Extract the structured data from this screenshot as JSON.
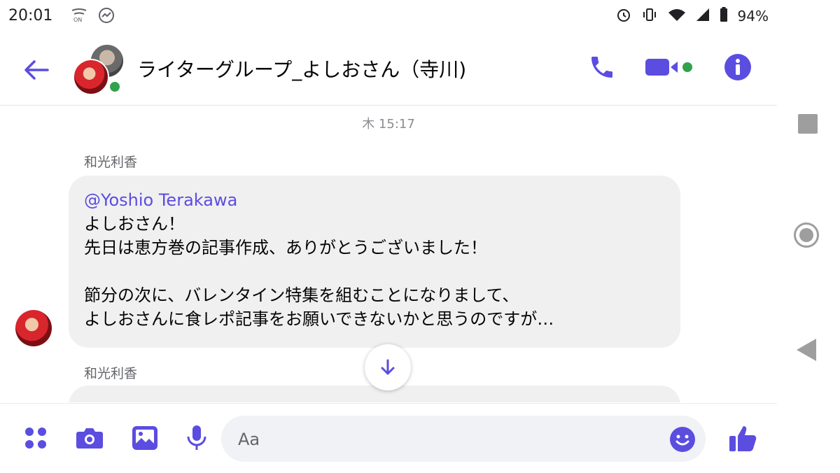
{
  "status_bar": {
    "time": "20:01",
    "battery": "94%"
  },
  "header": {
    "title": "ライターグループ_よしおさん（寺川)"
  },
  "chat": {
    "timestamp": "木 15:17",
    "messages": [
      {
        "sender": "和光利香",
        "mention": "@Yoshio Terakawa",
        "body": "よしおさん！\n先日は恵方巻の記事作成、ありがとうございました！\n\n節分の次に、バレンタイン特集を組むことになりまして、\nよしおさんに食レポ記事をお願いできないかと思うのですが…"
      },
      {
        "sender": "和光利香"
      }
    ]
  },
  "composer": {
    "placeholder": "Aa"
  },
  "colors": {
    "accent": "#5b4de0",
    "online": "#31a24c",
    "bubble": "#f0f0f0"
  },
  "icons": {
    "back": "arrow-left-icon",
    "call": "phone-icon",
    "video": "video-camera-icon",
    "info": "info-icon",
    "apps": "four-dots-icon",
    "camera": "camera-icon",
    "gallery": "image-icon",
    "mic": "microphone-icon",
    "emoji": "smiley-icon",
    "like": "thumbs-up-icon",
    "scroll": "arrow-down-icon"
  }
}
